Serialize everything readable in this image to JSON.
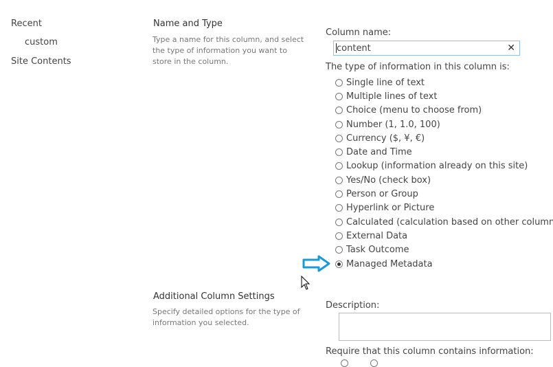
{
  "nav": {
    "recent": "Recent",
    "custom": "custom",
    "site_contents": "Site Contents"
  },
  "sections": {
    "name_type": {
      "title": "Name and Type",
      "description": "Type a name for this column, and select the type of information you want to store in the column."
    },
    "additional": {
      "title": "Additional Column Settings",
      "description": "Specify detailed options for the type of information you selected."
    }
  },
  "column_name": {
    "label": "Column name:",
    "value": "content",
    "clear_icon": "close-icon"
  },
  "type_question": "The type of information in this column is:",
  "types": [
    {
      "label": "Single line of text",
      "checked": false
    },
    {
      "label": "Multiple lines of text",
      "checked": false
    },
    {
      "label": "Choice (menu to choose from)",
      "checked": false
    },
    {
      "label": "Number (1, 1.0, 100)",
      "checked": false
    },
    {
      "label": "Currency ($, ¥, €)",
      "checked": false
    },
    {
      "label": "Date and Time",
      "checked": false
    },
    {
      "label": "Lookup (information already on this site)",
      "checked": false
    },
    {
      "label": "Yes/No (check box)",
      "checked": false
    },
    {
      "label": "Person or Group",
      "checked": false
    },
    {
      "label": "Hyperlink or Picture",
      "checked": false
    },
    {
      "label": "Calculated (calculation based on other columns)",
      "checked": false
    },
    {
      "label": "External Data",
      "checked": false
    },
    {
      "label": "Task Outcome",
      "checked": false
    },
    {
      "label": "Managed Metadata",
      "checked": true
    }
  ],
  "description": {
    "label": "Description:",
    "value": ""
  },
  "require": {
    "label": "Require that this column contains information:"
  },
  "annotations": {
    "arrow_icon": "arrow-right-icon",
    "arrow_color": "#1a9ad6",
    "cursor_icon": "mouse-pointer-icon"
  }
}
